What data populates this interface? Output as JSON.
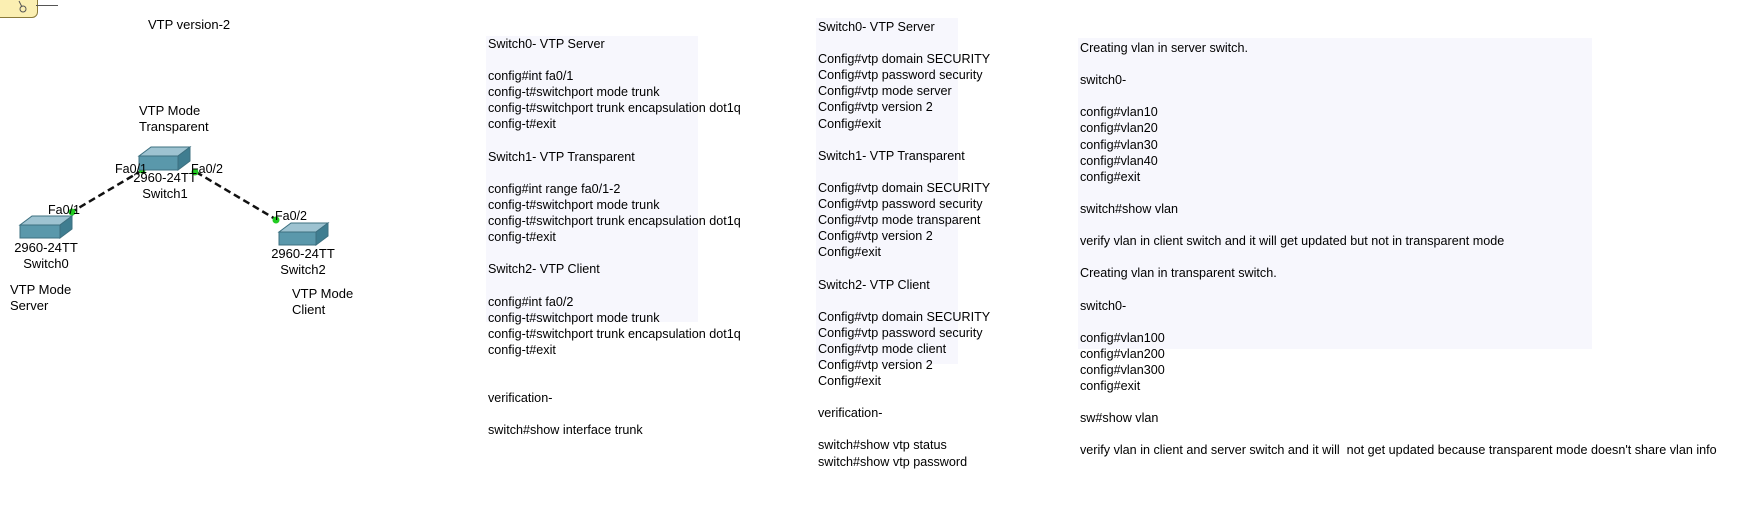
{
  "title": "VTP version-2",
  "topology": {
    "devices": [
      {
        "id": "switch0",
        "model": "2960-24TT",
        "name": "Switch0",
        "mode_label": [
          "VTP Mode",
          "Server"
        ]
      },
      {
        "id": "switch1",
        "model": "2960-24TT",
        "name": "Switch1",
        "mode_label": [
          "VTP Mode",
          "Transparent"
        ]
      },
      {
        "id": "switch2",
        "model": "2960-24TT",
        "name": "Switch2",
        "mode_label": [
          "VTP Mode",
          "Client"
        ]
      }
    ],
    "ports": {
      "sw0_fa01": "Fa0/1",
      "sw1_fa01": "Fa0/1",
      "sw1_fa02": "Fa0/2",
      "sw2_fa02": "Fa0/2"
    },
    "link_status_color": "#22cc22",
    "device_color": "#4f8fa3"
  },
  "notes": [
    {
      "id": "trunk-config",
      "lines": [
        "Switch0- VTP Server",
        "",
        "config#int fa0/1",
        "config-t#switchport mode trunk",
        "config-t#switchport trunk encapsulation dot1q",
        "config-t#exit",
        "",
        "Switch1- VTP Transparent",
        "",
        "config#int range fa0/1-2",
        "config-t#switchport mode trunk",
        "config-t#switchport trunk encapsulation dot1q",
        "config-t#exit",
        "",
        "Switch2- VTP Client",
        "",
        "config#int fa0/2",
        "config-t#switchport mode trunk",
        "config-t#switchport trunk encapsulation dot1q",
        "config-t#exit",
        "",
        "",
        "verification-",
        "",
        "switch#show interface trunk"
      ]
    },
    {
      "id": "vtp-config",
      "lines": [
        "Switch0- VTP Server",
        "",
        "Config#vtp domain SECURITY",
        "Config#vtp password security",
        "Config#vtp mode server",
        "Config#vtp version 2",
        "Config#exit",
        "",
        "Switch1- VTP Transparent",
        "",
        "Config#vtp domain SECURITY",
        "Config#vtp password security",
        "Config#vtp mode transparent",
        "Config#vtp version 2",
        "Config#exit",
        "",
        "Switch2- VTP Client",
        "",
        "Config#vtp domain SECURITY",
        "Config#vtp password security",
        "Config#vtp mode client",
        "Config#vtp version 2",
        "Config#exit",
        "",
        "verification-",
        "",
        "switch#show vtp status",
        "switch#show vtp password"
      ]
    },
    {
      "id": "vlan-config",
      "lines": [
        "Creating vlan in server switch.",
        "",
        "switch0-",
        "",
        "config#vlan10",
        "config#vlan20",
        "config#vlan30",
        "config#vlan40",
        "config#exit",
        "",
        "switch#show vlan",
        "",
        "verify vlan in client switch and it will get updated but not in transparent mode",
        "",
        "Creating vlan in transparent switch.",
        "",
        "switch0-",
        "",
        "config#vlan100",
        "config#vlan200",
        "config#vlan300",
        "config#exit",
        "",
        "sw#show vlan",
        "",
        "verify vlan in client and server switch and it will  not get updated because transparent mode doesn't share vlan info"
      ]
    }
  ]
}
